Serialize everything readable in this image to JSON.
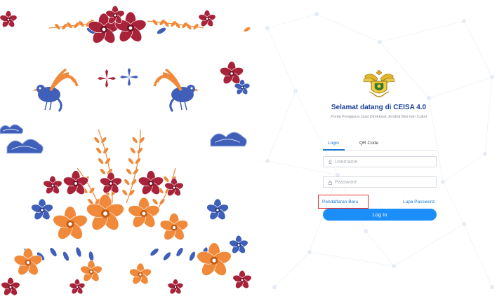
{
  "brand": {
    "welcome": "Selamat datang di CEISA 4.0",
    "subtitle": "Portal Pengguna Jasa Direktorat Jendral Bea dan Cukai",
    "logo_icon": "customs-emblem-icon"
  },
  "tabs": [
    {
      "label": "Login",
      "active": true
    },
    {
      "label": "QR Code",
      "active": false
    }
  ],
  "form": {
    "username_placeholder": "Username",
    "password_placeholder": "Password",
    "username_icon": "user-icon",
    "password_icon": "lock-icon"
  },
  "links": {
    "register": "Pendaftaran Baru",
    "forgot_password": "Lupa Password"
  },
  "login_button": "Log In",
  "colors": {
    "accent": "#1976d2",
    "button": "#1c8ef9",
    "title": "#1b3f9a",
    "highlight": "#e03131",
    "batik_orange": "#f0893a",
    "batik_red": "#a8233a",
    "batik_blue": "#3f5fb8"
  }
}
